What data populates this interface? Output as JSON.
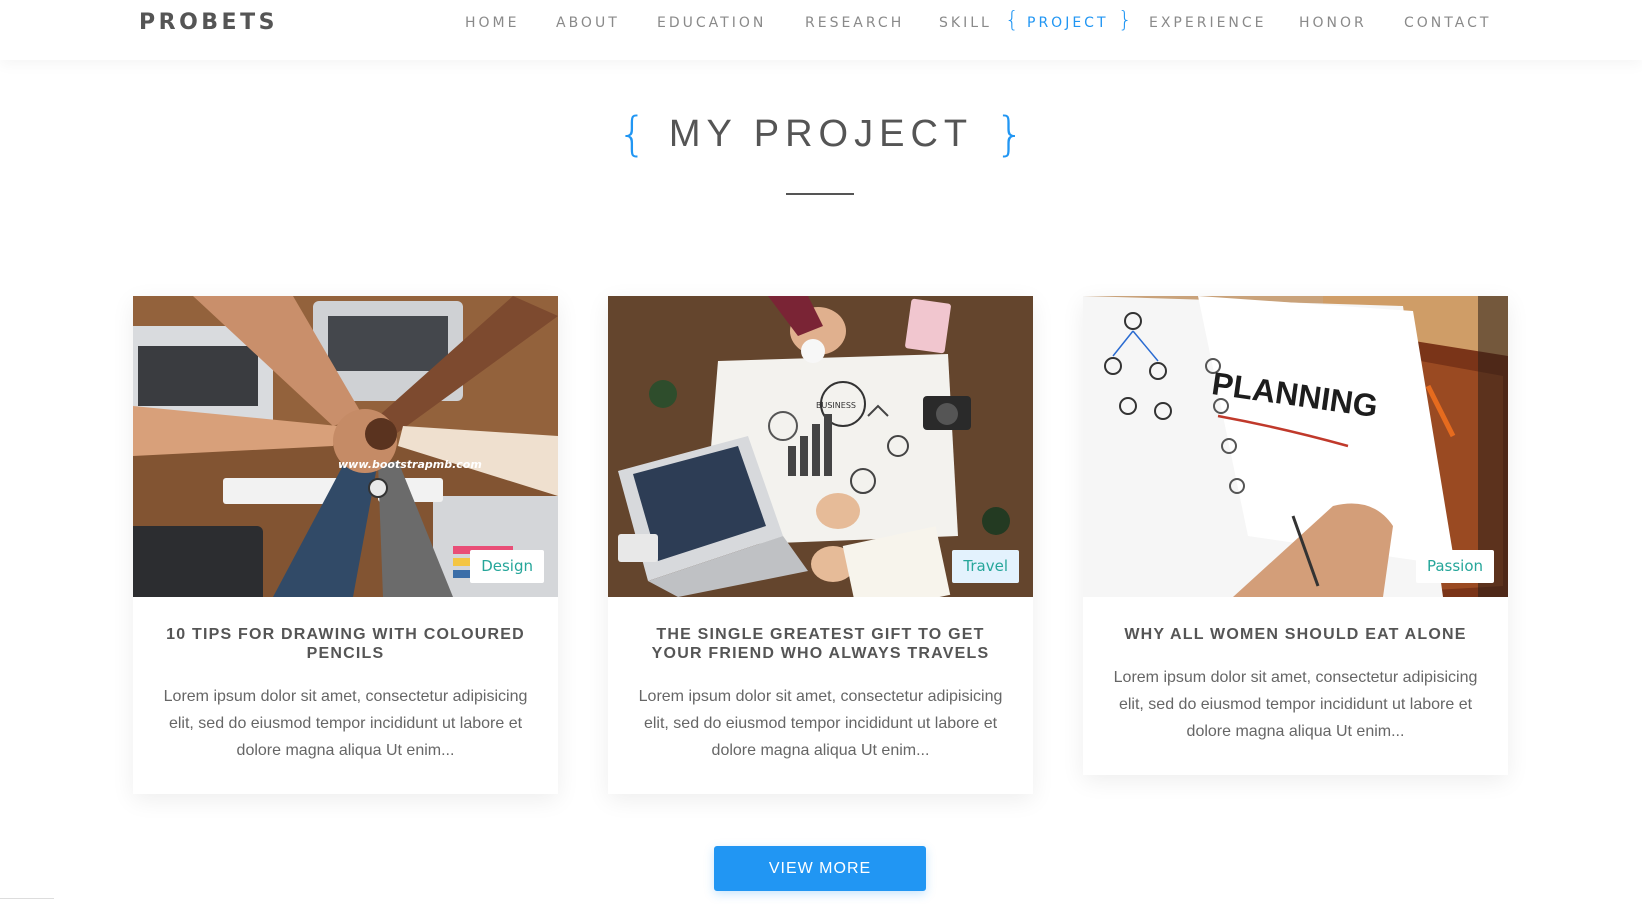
{
  "brand": "PROBETS",
  "nav": {
    "items": [
      {
        "label": "HOME"
      },
      {
        "label": "ABOUT"
      },
      {
        "label": "EDUCATION"
      },
      {
        "label": "RESEARCH"
      },
      {
        "label": "SKILL"
      },
      {
        "label": "PROJECT"
      },
      {
        "label": "EXPERIENCE"
      },
      {
        "label": "HONOR"
      },
      {
        "label": "CONTACT"
      }
    ],
    "active": "PROJECT",
    "brace_open": "{",
    "brace_close": "}"
  },
  "section": {
    "title": "MY PROJECT",
    "brace_open": "{",
    "brace_close": "}"
  },
  "cards": [
    {
      "tag": "Design",
      "title": "10 TIPS FOR DRAWING WITH COLOURED PENCILS",
      "text": "Lorem ipsum dolor sit amet, consectetur adipisicing elit, sed do eiusmod tempor incididunt ut labore et dolore magna aliqua Ut enim...",
      "image_caption": "www.bootstrapmb.com"
    },
    {
      "tag": "Travel",
      "title": "THE SINGLE GREATEST GIFT TO GET YOUR FRIEND WHO ALWAYS TRAVELS",
      "text": "Lorem ipsum dolor sit amet, consectetur adipisicing elit, sed do eiusmod tempor incididunt ut labore et dolore magna aliqua Ut enim...",
      "image_caption": "BUSINESS"
    },
    {
      "tag": "Passion",
      "title": "WHY ALL WOMEN SHOULD EAT ALONE",
      "text": "Lorem ipsum dolor sit amet, consectetur adipisicing elit, sed do eiusmod tempor incididunt ut labore et dolore magna aliqua Ut enim...",
      "image_caption": "PLANNING"
    }
  ],
  "view_more": "VIEW MORE",
  "colors": {
    "accent": "#2196f3",
    "tag_text": "#26a69a",
    "text": "#555555"
  }
}
